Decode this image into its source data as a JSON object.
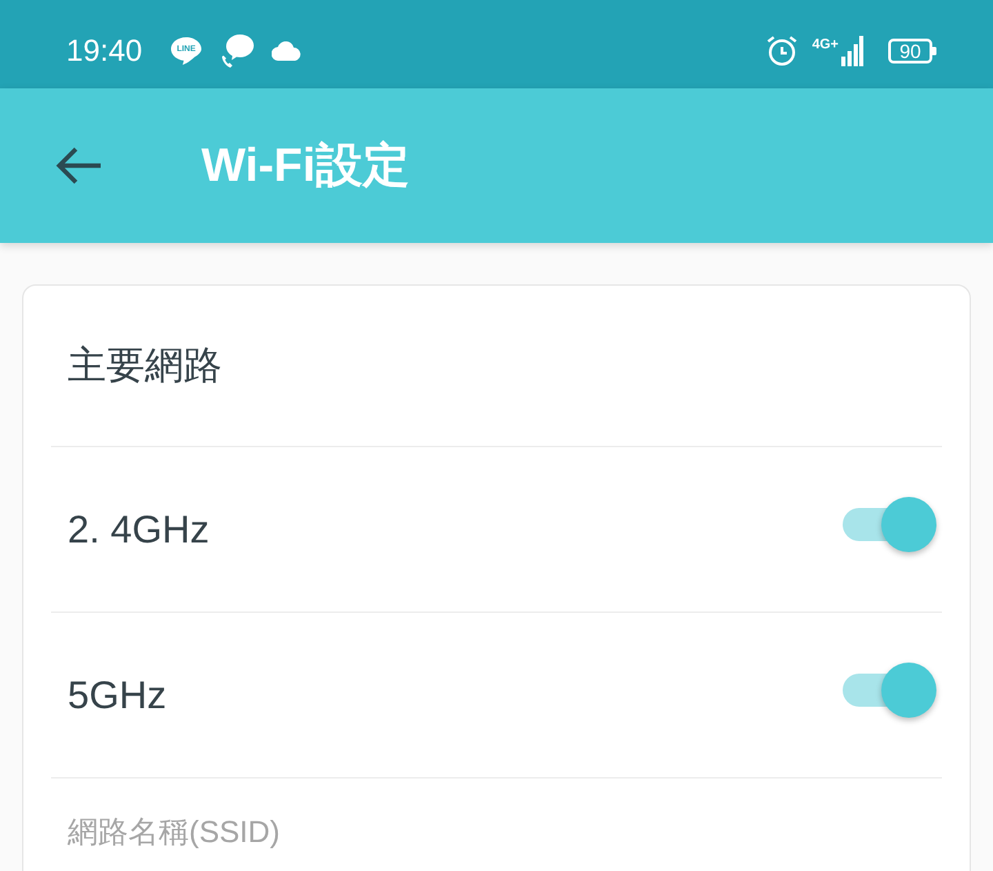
{
  "status_bar": {
    "time": "19:40",
    "notifications": [
      {
        "kind": "line",
        "text": "LINE"
      },
      {
        "kind": "chat"
      },
      {
        "kind": "cloud"
      }
    ],
    "network": "4G+",
    "battery": "90"
  },
  "app_bar": {
    "title": "Wi-Fi設定"
  },
  "card": {
    "title": "主要網路",
    "bands": [
      {
        "label": "2. 4GHz",
        "on": true
      },
      {
        "label": "5GHz",
        "on": true
      }
    ],
    "field": {
      "label": "網路名稱(SSID)"
    }
  }
}
